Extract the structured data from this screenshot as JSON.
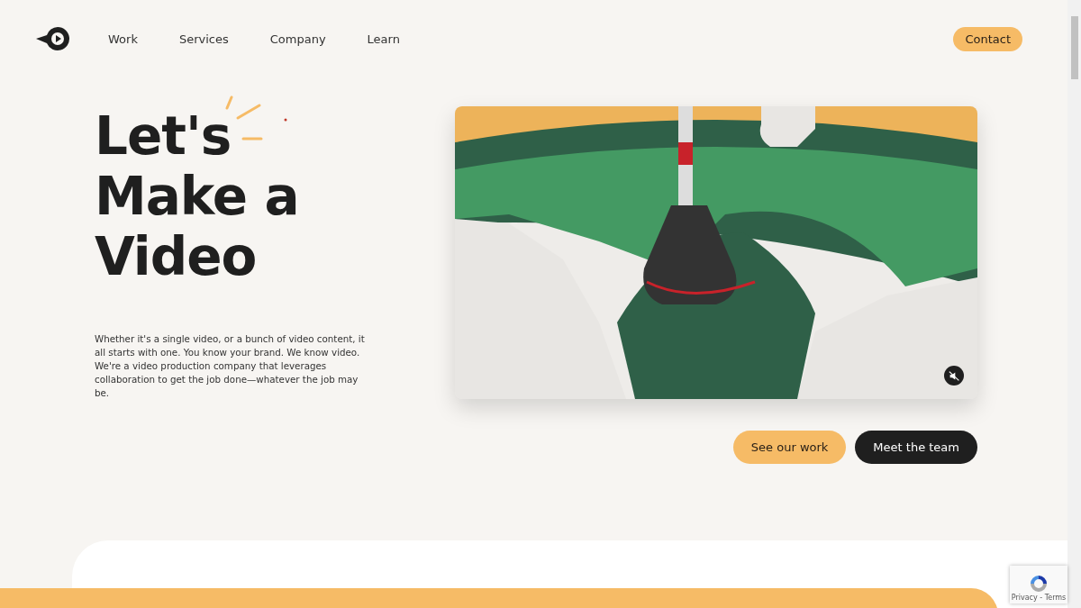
{
  "nav": {
    "links": [
      "Work",
      "Services",
      "Company",
      "Learn"
    ],
    "contact": "Contact"
  },
  "hero": {
    "title_lines": [
      "Let's",
      "Make a",
      "Video"
    ],
    "body": "Whether it's a single video, or a bunch of video content, it all starts with one. You know your brand. We know video. We're a video production company that leverages collaboration to get the job done—whatever the job may be."
  },
  "video": {
    "muted": true
  },
  "buttons": [
    {
      "label": "See our work",
      "kind": "primary"
    },
    {
      "label": "Meet the team",
      "kind": "dark"
    }
  ],
  "recaptcha": {
    "links": "Privacy - Terms"
  }
}
